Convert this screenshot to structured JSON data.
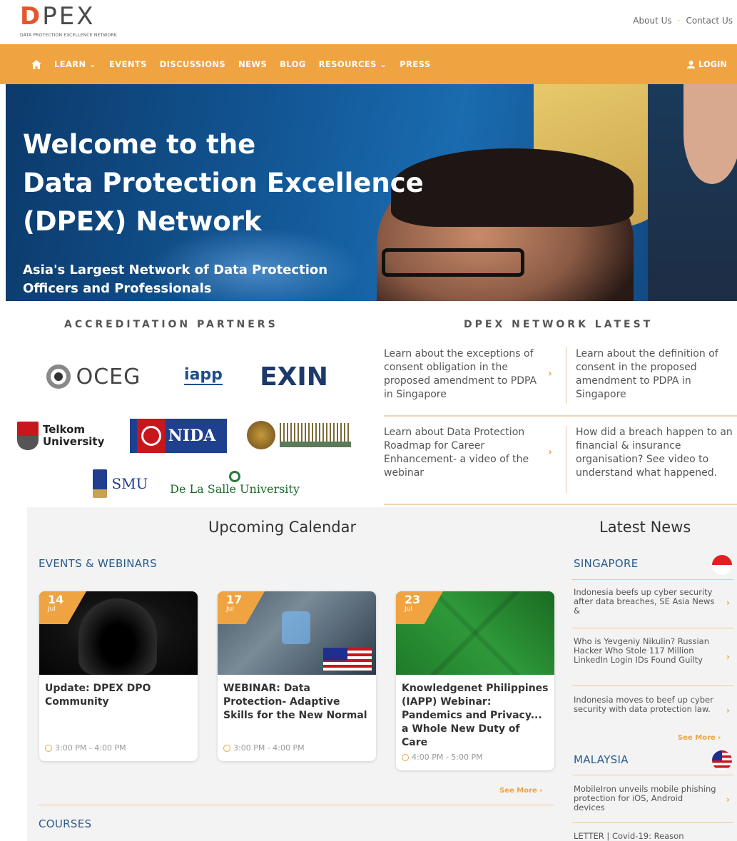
{
  "header": {
    "logo_text": "DPEX",
    "logo_tagline": "DATA PROTECTION EXCELLENCE NETWORK",
    "about_label": "About Us",
    "contact_label": "Contact Us"
  },
  "nav": {
    "items": [
      "LEARN ⌄",
      "EVENTS",
      "DISCUSSIONS",
      "NEWS",
      "BLOG",
      "RESOURCES ⌄",
      "PRESS"
    ],
    "login_label": "LOGIN",
    "bg_color": "#f0a341"
  },
  "hero": {
    "title_line1": "Welcome to the",
    "title_line2": "Data Protection Excellence",
    "title_line3": "(DPEX) Network",
    "subtitle_line1": "Asia's Largest Network of Data Protection",
    "subtitle_line2": "Officers and Professionals"
  },
  "accreditation": {
    "title": "ACCREDITATION PARTNERS",
    "partners": [
      "OCEG",
      "iapp",
      "EXIN",
      "Telkom University",
      "NIDA",
      "SMU",
      "De La Salle University"
    ]
  },
  "network_latest": {
    "title": "DPEX NETWORK LATEST",
    "articles": [
      "Learn about the exceptions of consent obligation in the proposed amendment to PDPA in Singapore",
      "Learn about the definition of consent in the proposed amendment to PDPA in Singapore",
      "Learn about Data Protection Roadmap for Career Enhancement- a video of the webinar",
      "How did a breach happen to an financial & insurance organisation? See video to understand what happened."
    ]
  },
  "calendar": {
    "title": "Upcoming Calendar",
    "events_label": "EVENTS & WEBINARS",
    "events": [
      {
        "day": "14",
        "month": "Jul",
        "title": "Update: DPEX DPO Community",
        "time": "3:00 PM - 4:00 PM"
      },
      {
        "day": "17",
        "month": "Jul",
        "title": "WEBINAR: Data Protection- Adaptive Skills for the New Normal",
        "time": "3:00 PM - 4:00 PM"
      },
      {
        "day": "23",
        "month": "Jul",
        "title": "Knowledgenet Philippines (IAPP) Webinar: Pandemics and Privacy... a Whole New Duty of Care",
        "time": "4:00 PM - 5:00 PM"
      }
    ],
    "see_more": "See More ›",
    "courses_label": "COURSES"
  },
  "news": {
    "title": "Latest News",
    "singapore_label": "SINGAPORE",
    "singapore_items": [
      "Indonesia beefs up cyber security after data breaches, SE Asia News &",
      "Who is Yevgeniy Nikulin? Russian Hacker Who Stole 117 Million LinkedIn Login IDs Found Guilty",
      "Indonesia moves to beef up cyber security with data protection law."
    ],
    "see_more": "See More ›",
    "malaysia_label": "MALAYSIA",
    "malaysia_items": [
      "MobileIron unveils mobile phishing protection for iOS, Android devices",
      "LETTER | Covid-19: Reason"
    ]
  }
}
